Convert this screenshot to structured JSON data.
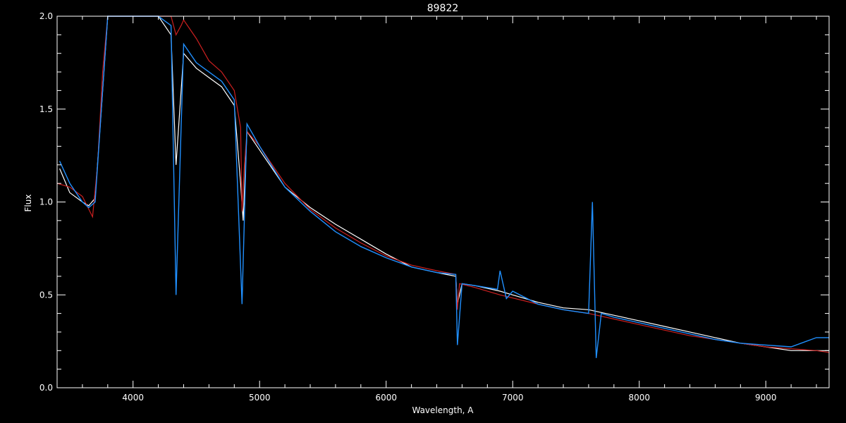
{
  "chart_data": {
    "type": "line",
    "title": "89822",
    "xlabel": "Wavelength, A",
    "ylabel": "Flux",
    "xlim": [
      3400,
      9500
    ],
    "ylim": [
      0,
      2.0
    ],
    "x_ticks": [
      4000,
      5000,
      6000,
      7000,
      8000,
      9000
    ],
    "x_tick_labels": [
      "4000",
      "5000",
      "6000",
      "7000",
      "8000",
      "9000"
    ],
    "y_ticks": [
      0,
      0.5,
      1.0,
      1.5,
      2.0
    ],
    "y_tick_labels": [
      "0.0",
      "0.5",
      "1.0",
      "1.5",
      "2.0"
    ],
    "grid": false,
    "colors": {
      "background": "#000000",
      "axes": "#ffffff",
      "observed": "#ffffff",
      "model": "#cc2020",
      "overlay": "#2090ff"
    },
    "series": [
      {
        "color": "#ffffff",
        "x": [
          3420,
          3500,
          3600,
          3650,
          3700,
          3750,
          3800,
          3850,
          3900,
          4000,
          4100,
          4200,
          4300,
          4340,
          4400,
          4500,
          4600,
          4700,
          4800,
          4850,
          4870,
          4900,
          5000,
          5100,
          5200,
          5400,
          5600,
          5800,
          6000,
          6200,
          6400,
          6550,
          6563,
          6600,
          6700,
          6900,
          7000,
          7200,
          7400,
          7600,
          7800,
          8000,
          8200,
          8400,
          8600,
          8800,
          9000,
          9200,
          9400,
          9500
        ],
        "y": [
          1.18,
          1.05,
          1.0,
          0.98,
          1.02,
          1.5,
          2.0,
          2.0,
          2.0,
          2.0,
          2.0,
          2.0,
          1.9,
          1.2,
          1.8,
          1.72,
          1.67,
          1.62,
          1.52,
          1.1,
          0.9,
          1.38,
          1.28,
          1.18,
          1.08,
          0.97,
          0.88,
          0.8,
          0.72,
          0.65,
          0.62,
          0.6,
          0.45,
          0.56,
          0.55,
          0.52,
          0.5,
          0.46,
          0.43,
          0.42,
          0.39,
          0.36,
          0.33,
          0.3,
          0.27,
          0.24,
          0.22,
          0.2,
          0.2,
          0.2
        ]
      },
      {
        "color": "#cc2020",
        "x": [
          3400,
          3500,
          3600,
          3680,
          3720,
          3760,
          3800,
          3900,
          4000,
          4100,
          4200,
          4300,
          4340,
          4380,
          4400,
          4500,
          4600,
          4700,
          4800,
          4850,
          4861,
          4880,
          4900,
          5000,
          5200,
          5400,
          5600,
          5800,
          6000,
          6200,
          6400,
          6550,
          6563,
          6580,
          6700,
          6900,
          7200,
          7400,
          7600,
          7800,
          8000,
          8200,
          8400,
          8600,
          8800,
          9000,
          9200,
          9400,
          9500
        ],
        "y": [
          1.1,
          1.08,
          1.03,
          0.92,
          1.2,
          1.7,
          2.0,
          2.0,
          2.0,
          2.0,
          2.0,
          2.0,
          1.9,
          1.95,
          1.98,
          1.88,
          1.76,
          1.7,
          1.6,
          1.4,
          0.95,
          1.2,
          1.38,
          1.3,
          1.1,
          0.96,
          0.86,
          0.78,
          0.71,
          0.66,
          0.63,
          0.61,
          0.42,
          0.56,
          0.54,
          0.5,
          0.45,
          0.42,
          0.4,
          0.37,
          0.34,
          0.31,
          0.28,
          0.26,
          0.24,
          0.22,
          0.21,
          0.2,
          0.19
        ]
      },
      {
        "color": "#2090ff",
        "x": [
          3420,
          3500,
          3600,
          3650,
          3700,
          3750,
          3800,
          3900,
          4000,
          4100,
          4200,
          4300,
          4340,
          4400,
          4500,
          4600,
          4700,
          4800,
          4861,
          4900,
          5000,
          5200,
          5400,
          5600,
          5800,
          6000,
          6200,
          6400,
          6550,
          6563,
          6600,
          6700,
          6880,
          6900,
          6950,
          7000,
          7200,
          7400,
          7600,
          7630,
          7660,
          7700,
          7800,
          8000,
          8200,
          8400,
          8600,
          8800,
          9000,
          9200,
          9400,
          9500
        ],
        "y": [
          1.22,
          1.1,
          1.0,
          0.97,
          1.0,
          1.5,
          2.0,
          2.0,
          2.0,
          2.0,
          2.0,
          1.95,
          0.5,
          1.85,
          1.75,
          1.7,
          1.65,
          1.55,
          0.45,
          1.42,
          1.3,
          1.08,
          0.95,
          0.84,
          0.76,
          0.7,
          0.65,
          0.62,
          0.61,
          0.23,
          0.56,
          0.55,
          0.53,
          0.63,
          0.48,
          0.52,
          0.45,
          0.42,
          0.4,
          1.0,
          0.16,
          0.4,
          0.38,
          0.35,
          0.32,
          0.29,
          0.26,
          0.24,
          0.23,
          0.22,
          0.27,
          0.27
        ]
      }
    ]
  }
}
